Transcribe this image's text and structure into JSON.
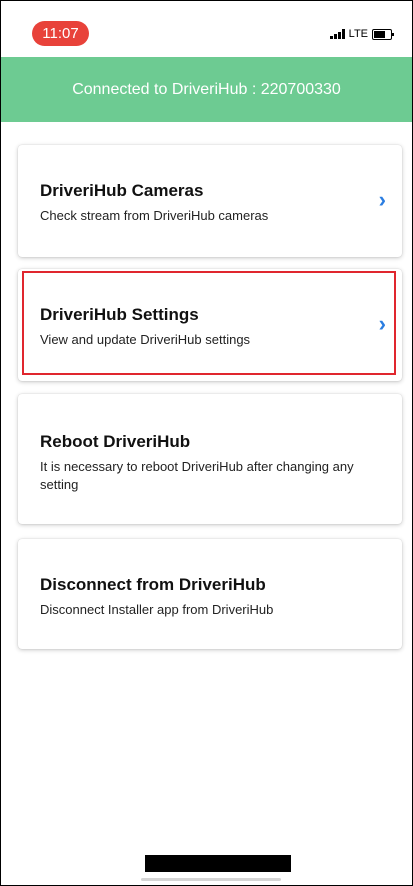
{
  "status_bar": {
    "time": "11:07",
    "network": "LTE",
    "icons": [
      "signal-icon",
      "battery-icon"
    ]
  },
  "header": {
    "text": "Connected to DriveriHub : 220700330",
    "color": "#6dcb92"
  },
  "menu": {
    "items": [
      {
        "title": "DriveriHub Cameras",
        "subtitle": "Check stream from DriveriHub cameras",
        "icon": "chevron-right-icon"
      },
      {
        "title": "DriveriHub Settings",
        "subtitle": "View and update DriveriHub settings",
        "icon": "chevron-right-icon",
        "highlighted": true
      },
      {
        "title": "Reboot DriveriHub",
        "subtitle": "It is necessary to reboot DriveriHub after changing any setting"
      },
      {
        "title": "Disconnect from DriveriHub",
        "subtitle": "Disconnect Installer app from DriveriHub"
      }
    ]
  },
  "colors": {
    "accent": "#2a7de1",
    "time_pill": "#e8423a",
    "highlight": "#e0262e"
  }
}
